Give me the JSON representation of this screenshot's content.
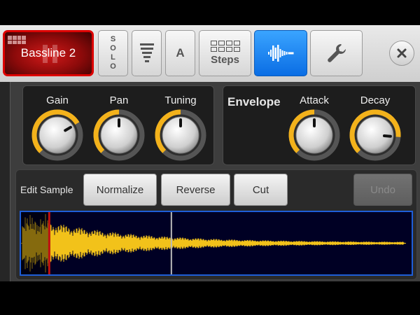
{
  "toolbar": {
    "track_label": "Bassline 2",
    "solo_label": "SOLO",
    "pattern_letter": "A",
    "steps_label": "Steps",
    "active_tool": "waveform-editor",
    "accent_active": "#0a6de4",
    "track_color": "#cc0000"
  },
  "knobs_left": {
    "gain": {
      "label": "Gain",
      "level": 0.72
    },
    "pan": {
      "label": "Pan",
      "level": 0.5
    },
    "tuning": {
      "label": "Tuning",
      "level": 0.5
    }
  },
  "envelope": {
    "title": "Envelope",
    "attack": {
      "label": "Attack",
      "level": 0.5
    },
    "decay": {
      "label": "Decay",
      "level": 0.85
    }
  },
  "edit_sample": {
    "label": "Edit Sample",
    "normalize": "Normalize",
    "reverse": "Reverse",
    "cut": "Cut",
    "undo": "Undo",
    "playhead_position": 0.385,
    "selection_end": 0.075,
    "wave_color": "#f2c21a"
  }
}
